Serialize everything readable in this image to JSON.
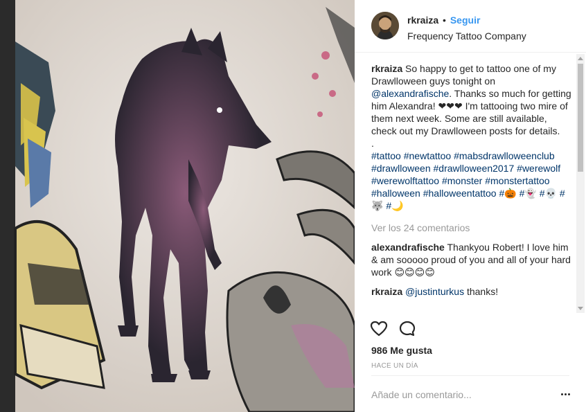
{
  "post": {
    "username": "rkraiza",
    "separator": "•",
    "follow_label": "Seguir",
    "location": "Frequency Tattoo Company"
  },
  "caption": {
    "author": "rkraiza",
    "text_1": "So happy to get to tattoo one of my Drawlloween guys tonight on",
    "mention": "@alexandrafische",
    "text_2": ". Thanks so much for getting him Alexandra! ❤❤❤ I'm tattooing two mire of them next week. Some are still available, check out my Drawlloween posts for details.",
    "dot_line": ".",
    "hashtags": [
      "#tattoo",
      "#newtattoo",
      "#mabsdrawlloweenclub",
      "#drawlloween",
      "#drawlloween2017",
      "#werewolf",
      "#werewolftattoo",
      "#monster",
      "#monstertattoo",
      "#halloween",
      "#halloweentattoo",
      "#🎃",
      "#👻",
      "#💀",
      "#🐺",
      "#🌙"
    ]
  },
  "view_all_label": "Ver los 24 comentarios",
  "comments": [
    {
      "author": "alexandrafische",
      "text": "Thankyou Robert! I love him & am sooooo proud of you and all of your hard work 😊😊😊😊"
    },
    {
      "author": "rkraiza",
      "mention": "@justinturkus",
      "text": "thanks!"
    }
  ],
  "icons": {
    "like": "heart-icon",
    "comment": "comment-bubble-icon",
    "more": "more-options-icon"
  },
  "likes_label": "986 Me gusta",
  "time_label": "HACE UN DÍA",
  "add_comment_placeholder": "Añade un comentario...",
  "colors": {
    "link": "#3897f0",
    "mention": "#003569",
    "muted": "#999999"
  }
}
